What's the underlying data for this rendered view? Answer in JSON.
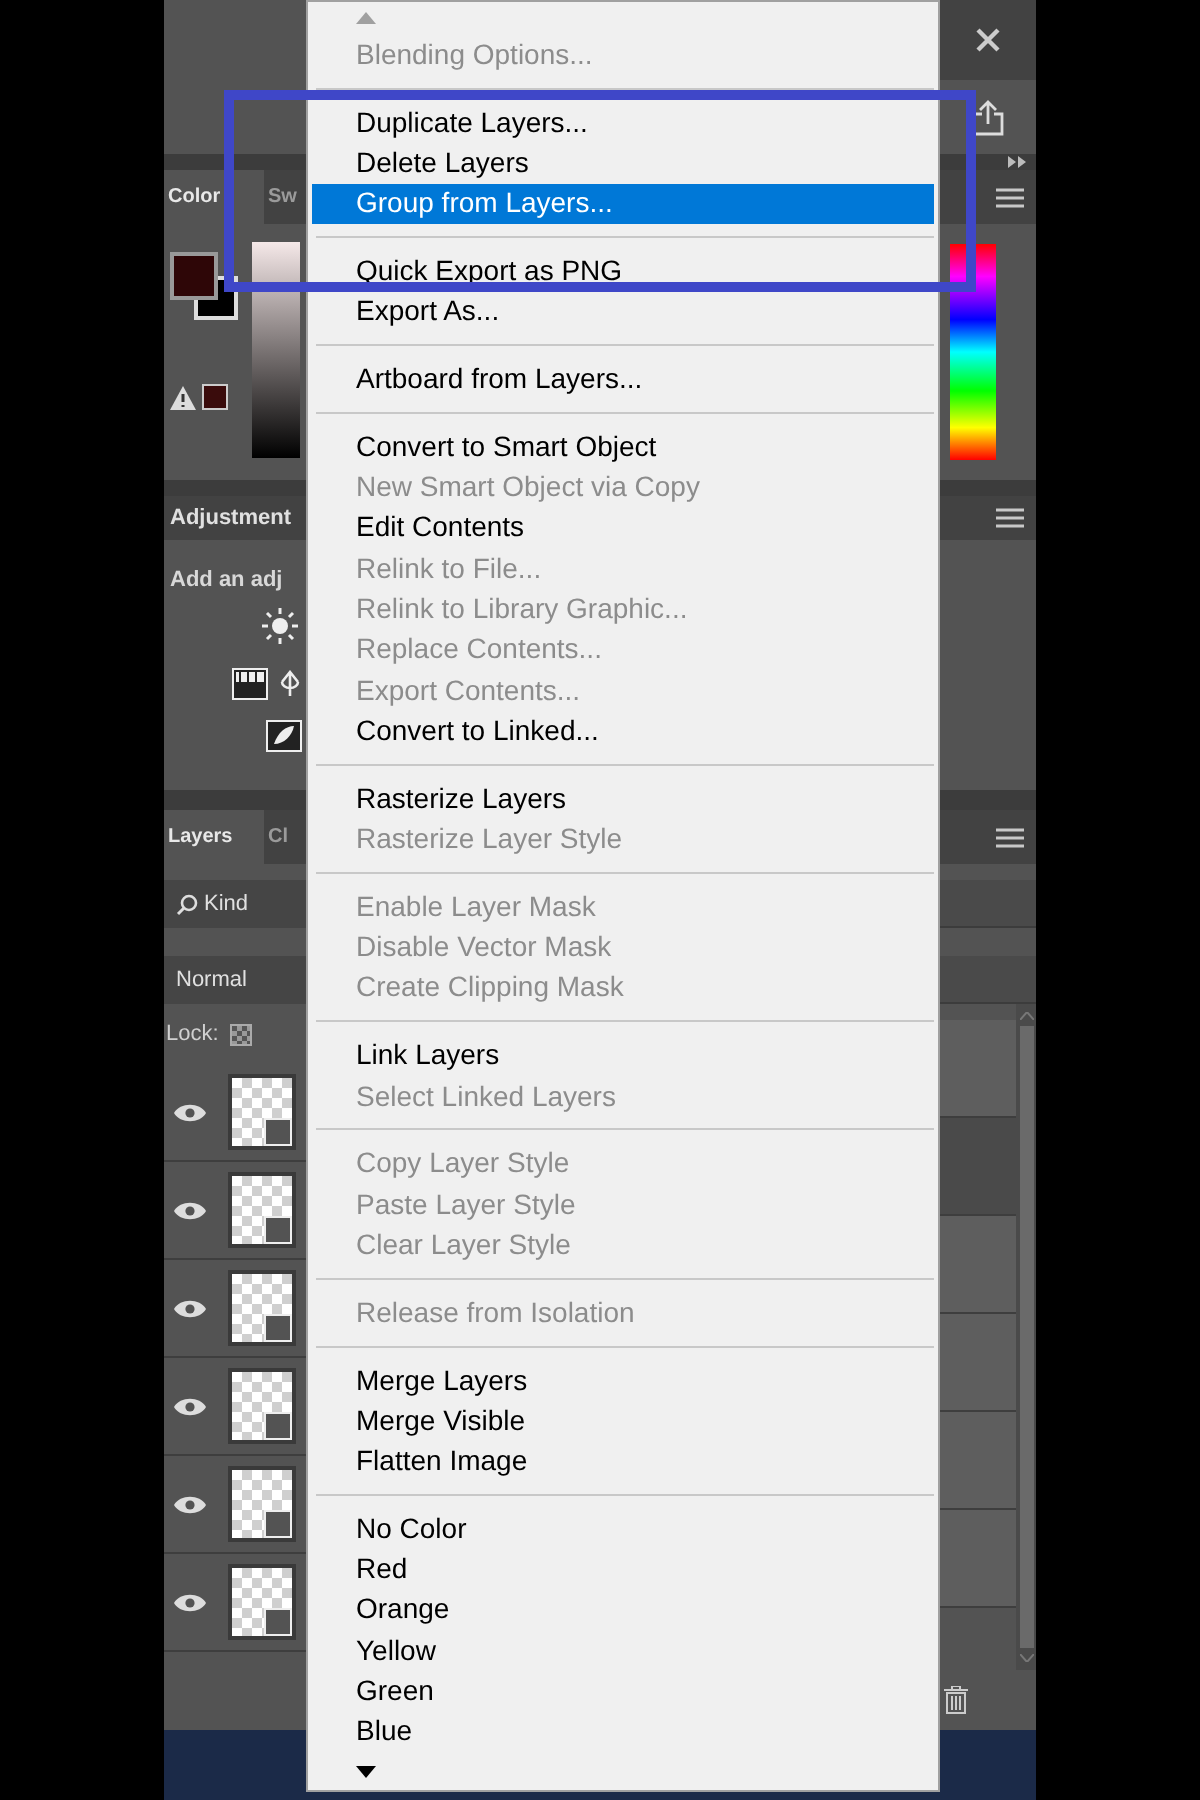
{
  "left_panel": {
    "color_tabs": [
      {
        "label": "Color",
        "selected": true
      },
      {
        "label": "Sw",
        "selected": false
      }
    ],
    "adjustments": {
      "title": "Adjustment",
      "hint": "Add an adj"
    },
    "layers_tabs": [
      {
        "label": "Layers",
        "selected": true
      },
      {
        "label": "Cl",
        "selected": false
      }
    ],
    "filter": {
      "value": "Kind"
    },
    "blend_mode": {
      "value": "Normal"
    },
    "lock_label": "Lock:",
    "layers": [
      {
        "visible": true
      },
      {
        "visible": true
      },
      {
        "visible": true
      },
      {
        "visible": true
      },
      {
        "visible": true
      },
      {
        "visible": true
      }
    ]
  },
  "context_menu": {
    "groups": [
      [
        {
          "label": "Blending Options...",
          "disabled": true,
          "selected": false
        }
      ],
      [
        {
          "label": "Duplicate Layers...",
          "disabled": false,
          "selected": false
        },
        {
          "label": "Delete Layers",
          "disabled": false,
          "selected": false
        },
        {
          "label": "Group from Layers...",
          "disabled": false,
          "selected": true
        }
      ],
      [
        {
          "label": "Quick Export as PNG",
          "disabled": false,
          "selected": false
        },
        {
          "label": "Export As...",
          "disabled": false,
          "selected": false
        }
      ],
      [
        {
          "label": "Artboard from Layers...",
          "disabled": false,
          "selected": false
        }
      ],
      [
        {
          "label": "Convert to Smart Object",
          "disabled": false,
          "selected": false
        },
        {
          "label": "New Smart Object via Copy",
          "disabled": true,
          "selected": false
        },
        {
          "label": "Edit Contents",
          "disabled": false,
          "selected": false
        },
        {
          "label": "Relink to File...",
          "disabled": true,
          "selected": false
        },
        {
          "label": "Relink to Library Graphic...",
          "disabled": true,
          "selected": false
        },
        {
          "label": "Replace Contents...",
          "disabled": true,
          "selected": false
        },
        {
          "label": "Export Contents...",
          "disabled": true,
          "selected": false
        },
        {
          "label": "Convert to Linked...",
          "disabled": false,
          "selected": false
        }
      ],
      [
        {
          "label": "Rasterize Layers",
          "disabled": false,
          "selected": false
        },
        {
          "label": "Rasterize Layer Style",
          "disabled": true,
          "selected": false
        }
      ],
      [
        {
          "label": "Enable Layer Mask",
          "disabled": true,
          "selected": false
        },
        {
          "label": "Disable Vector Mask",
          "disabled": true,
          "selected": false
        },
        {
          "label": "Create Clipping Mask",
          "disabled": true,
          "selected": false
        }
      ],
      [
        {
          "label": "Link Layers",
          "disabled": false,
          "selected": false
        },
        {
          "label": "Select Linked Layers",
          "disabled": true,
          "selected": false
        }
      ],
      [
        {
          "label": "Copy Layer Style",
          "disabled": true,
          "selected": false
        },
        {
          "label": "Paste Layer Style",
          "disabled": true,
          "selected": false
        },
        {
          "label": "Clear Layer Style",
          "disabled": true,
          "selected": false
        }
      ],
      [
        {
          "label": "Release from Isolation",
          "disabled": true,
          "selected": false
        }
      ],
      [
        {
          "label": "Merge Layers",
          "disabled": false,
          "selected": false
        },
        {
          "label": "Merge Visible",
          "disabled": false,
          "selected": false
        },
        {
          "label": "Flatten Image",
          "disabled": false,
          "selected": false
        }
      ],
      [
        {
          "label": "No Color",
          "disabled": false,
          "selected": false
        },
        {
          "label": "Red",
          "disabled": false,
          "selected": false
        },
        {
          "label": "Orange",
          "disabled": false,
          "selected": false
        },
        {
          "label": "Yellow",
          "disabled": false,
          "selected": false
        },
        {
          "label": "Green",
          "disabled": false,
          "selected": false
        },
        {
          "label": "Blue",
          "disabled": false,
          "selected": false
        }
      ]
    ]
  }
}
